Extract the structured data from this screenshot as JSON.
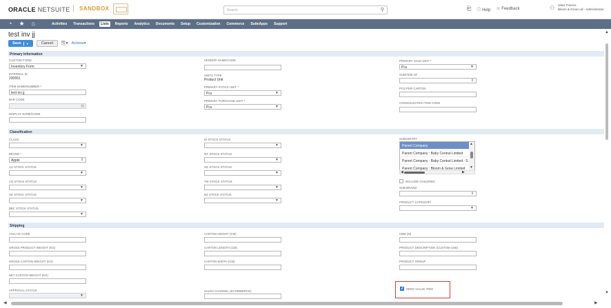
{
  "header": {
    "logo_main": "ORACLE",
    "logo_sub": "NETSUITE",
    "environment": "SANDBOX",
    "search_placeholder": "Search",
    "help": "Help",
    "feedback": "Feedback",
    "user_name": "Jalus Francis",
    "user_role": "Bloom & Grow Ltd - Administrator"
  },
  "nav": {
    "items": [
      "Activities",
      "Transactions",
      "Lists",
      "Reports",
      "Analytics",
      "Documents",
      "Setup",
      "Customization",
      "Commerce",
      "SuiteApps",
      "Support"
    ],
    "active": "Lists"
  },
  "page": {
    "title": "test inv jj",
    "save": "Save",
    "cancel": "Cancel",
    "actions": "Actions"
  },
  "sections": {
    "primary": "Primary Information",
    "classification": "Classification",
    "shipping": "Shipping"
  },
  "primary": {
    "custom_form_label": "CUSTOM FORM",
    "custom_form_value": "Inventory Form",
    "internal_id_label": "INTERNAL ID",
    "internal_id_value": "230551",
    "item_name_label": "ITEM NAME/NUMBER",
    "item_name_value": "test inv jj",
    "bar_code_label": "BAR CODE",
    "display_name_label": "DISPLAY NAME/CODE",
    "vendor_name_label": "VENDOR NAME/CODE",
    "units_type_label": "UNITS TYPE",
    "units_type_value": "Product Unit",
    "primary_stock_unit_label": "PRIMARY STOCK UNIT",
    "primary_stock_unit_value": "Pcs",
    "primary_purchase_unit_label": "PRIMARY PURCHASE UNIT",
    "primary_purchase_unit_value": "Pcs",
    "primary_sale_unit_label": "PRIMARY SALE UNIT",
    "primary_sale_unit_value": "Pcs",
    "subitem_of_label": "SUBITEM OF",
    "pcs_per_carton_label": "PCS PER CARTON",
    "consolidated_code_label": "CONSOLIDATED ITEM CODE"
  },
  "classification": {
    "class_label": "CLASS",
    "brand_label": "BRAND",
    "brand_value": "Apple",
    "au_stock_label": "AU STOCK STATUS",
    "cn_stock_label": "CN STOCK STATUS",
    "hk_stock_label": "HK STOCK STATUS",
    "bbc_stock_label": "BBC STOCK STATUS",
    "id_stock_label": "ID STOCK STATUS",
    "my_stock_label": "MY STOCK STATUS",
    "sg_stock_label": "SG STOCK STATUS",
    "tw_stock_label": "TW STOCK STATUS",
    "nz_stock_label": "NZ STOCK STATUS",
    "subsidiary_label": "SUBSIDIARY",
    "subsidiary_options": [
      "Parent Company",
      "Parent Company : Baby Central Limited",
      "Parent Company : Baby Central Limited : S",
      "Parent Company : Bloom & Grow Limited"
    ],
    "include_children_label": "INCLUDE CHILDREN",
    "sub_brand_label": "SUB-BRAND",
    "product_category_label": "PRODUCT CATEGORY"
  },
  "shipping": {
    "asia_hs_label": "ASIA HS CODE",
    "gross_product_weight_label": "GROSS PRODUCT WEIGHT (KG)",
    "gross_carton_weight_label": "GROSS CARTON WEIGHT (KG)",
    "net_carton_weight_label": "NET CARTON WEIGHT (KG)",
    "approval_status_label": "APPROVAL STATUS",
    "carton_height_label": "CARTON HEIGHT (CM)",
    "carton_length_label": "CARTON LENGTH (CM)",
    "carton_width_label": "CARTON WIDTH (CM)",
    "sales_channel_label": "SALES CHANNEL (ECOMMERCE)",
    "cbm_label": "CBM (M)",
    "product_desc_label": "PRODUCT DESCRIPTION (CUSTOM USE)",
    "product_group_label": "PRODUCT GROUP",
    "zero_value_label": "ZERO VALUE ITEM",
    "zero_value_checked": true
  },
  "colors": {
    "nav_bg": "#5d6e87",
    "accent": "#3d8ed9",
    "section_bg": "#e2ebf5",
    "highlight": "#d9393b"
  }
}
